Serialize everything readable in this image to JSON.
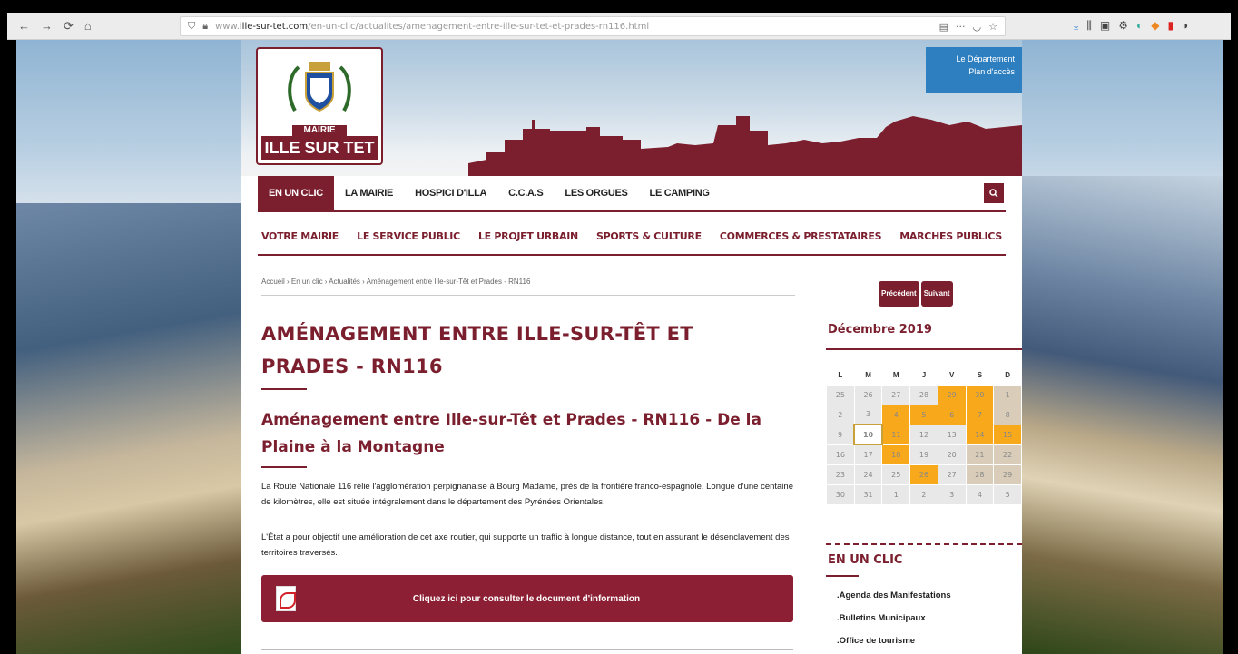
{
  "browser": {
    "nav_back": "←",
    "nav_forward": "→",
    "nav_reload": "⟳",
    "nav_home": "⌂",
    "url_prefix": "www.",
    "url_domain": "ille-sur-tet.com",
    "url_path": "/en-un-clic/actualites/amenagement-entre-ille-sur-tet-et-prades-rn116.html",
    "url_actions": "···",
    "toolbar_icons": [
      "download-icon",
      "library-icon",
      "sidebar-icon",
      "extension-icon",
      "extension-icon",
      "extension-icon",
      "extension-icon",
      "extension-icon"
    ]
  },
  "header": {
    "logo_mairie": "MAIRIE",
    "logo_name": "ILLE SUR TET",
    "dept_link": "Le Département",
    "plan_link": "Plan d'accès"
  },
  "main_nav": {
    "items": [
      "EN UN CLIC",
      "LA MAIRIE",
      "HOSPICI D'ILLA",
      "C.C.A.S",
      "LES ORGUES",
      "LE CAMPING"
    ],
    "search_icon": "search-icon"
  },
  "sub_nav": {
    "items": [
      "VOTRE MAIRIE",
      "LE SERVICE PUBLIC",
      "LE PROJET URBAIN",
      "SPORTS & CULTURE",
      "COMMERCES & PRESTATAIRES",
      "MARCHES PUBLICS"
    ]
  },
  "breadcrumb": "Accueil › En un clic › Actualités › Aménagement entre Ille-sur-Têt et Prades - RN116",
  "article": {
    "title": "AMÉNAGEMENT ENTRE ILLE-SUR-TÊT ET PRADES - RN116",
    "subtitle": "Aménagement entre Ille-sur-Têt et Prades - RN116 - De la Plaine à la Montagne",
    "para1": "La Route Nationale 116 relie l'agglomération perpignanaise à Bourg Madame, près de la frontière franco-espagnole. Longue d'une centaine de kilomètres, elle est située intégralement dans le département des Pyrénées Orientales.",
    "para2": "L'État a pour objectif une amélioration de cet axe routier, qui supporte un traffic à longue distance, tout en assurant le désenclavement des territoires traversés.",
    "pdf_label": "Cliquez ici pour consulter le document d'information"
  },
  "sidebar": {
    "prev": "Précédent",
    "next": "Suivant",
    "cal_title": "Décembre 2019",
    "weekdays": [
      "L",
      "M",
      "M",
      "J",
      "V",
      "S",
      "D"
    ],
    "weeks": [
      [
        [
          "25",
          "g"
        ],
        [
          "26",
          "g"
        ],
        [
          "27",
          "g"
        ],
        [
          "28",
          "g"
        ],
        [
          "29",
          "o"
        ],
        [
          "30",
          "o"
        ],
        [
          "1",
          "t"
        ]
      ],
      [
        [
          "2",
          "g"
        ],
        [
          "3",
          "g"
        ],
        [
          "4",
          "o"
        ],
        [
          "5",
          "o"
        ],
        [
          "6",
          "o"
        ],
        [
          "7",
          "o"
        ],
        [
          "8",
          "t"
        ]
      ],
      [
        [
          "9",
          "g"
        ],
        [
          "10",
          "today"
        ],
        [
          "11",
          "o"
        ],
        [
          "12",
          "g"
        ],
        [
          "13",
          "g"
        ],
        [
          "14",
          "o"
        ],
        [
          "15",
          "o"
        ]
      ],
      [
        [
          "16",
          "g"
        ],
        [
          "17",
          "g"
        ],
        [
          "18",
          "o"
        ],
        [
          "19",
          "g"
        ],
        [
          "20",
          "g"
        ],
        [
          "21",
          "t"
        ],
        [
          "22",
          "t"
        ]
      ],
      [
        [
          "23",
          "g"
        ],
        [
          "24",
          "g"
        ],
        [
          "25",
          "g"
        ],
        [
          "26",
          "o"
        ],
        [
          "27",
          "g"
        ],
        [
          "28",
          "t"
        ],
        [
          "29",
          "t"
        ]
      ],
      [
        [
          "30",
          "g"
        ],
        [
          "31",
          "g"
        ],
        [
          "1",
          "g"
        ],
        [
          "2",
          "g"
        ],
        [
          "3",
          "g"
        ],
        [
          "4",
          "g"
        ],
        [
          "5",
          "g"
        ]
      ]
    ],
    "clic_title": "EN UN CLIC",
    "clic_items": [
      ".Agenda des Manifestations",
      ".Bulletins Municipaux",
      ".Office de tourisme"
    ]
  },
  "colors": {
    "brand": "#7b1f2e",
    "accent": "#f7a81b",
    "dept": "#2d7fc0"
  }
}
